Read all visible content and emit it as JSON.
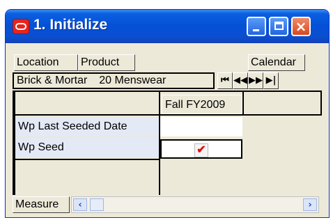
{
  "window": {
    "title": "1. Initialize"
  },
  "toolbar": {
    "location": "Location",
    "product": "Product",
    "calendar": "Calendar"
  },
  "context": {
    "location_value": "Brick & Mortar",
    "product_value": "20 Menswear"
  },
  "nav": {
    "first": "⏮",
    "prev": "◀◀",
    "next": "▶▶",
    "last": "▶|"
  },
  "grid": {
    "column_header": "Fall FY2009",
    "rows": [
      {
        "label": "Wp Last Seeded Date",
        "value": ""
      },
      {
        "label": "Wp Seed",
        "value": "✔"
      }
    ]
  },
  "footer": {
    "measure": "Measure"
  },
  "colors": {
    "titlebar": "#0450d6",
    "check": "#e01010"
  }
}
